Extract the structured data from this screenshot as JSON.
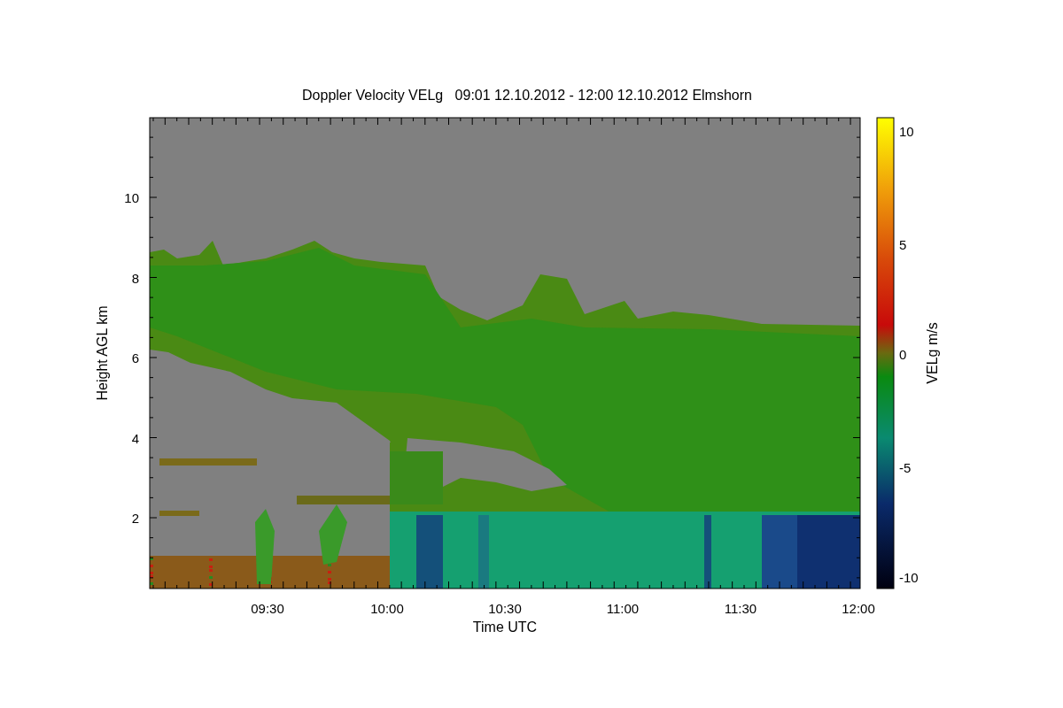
{
  "title": "Doppler Velocity VELg   09:01 12.10.2012 - 12:00 12.10.2012 Elmshorn",
  "plot": {
    "xlabel": "Time UTC",
    "ylabel": "Height AGL km",
    "xtick_labels": [
      "09:30",
      "10:00",
      "10:30",
      "11:00",
      "11:30",
      "12:00"
    ],
    "ytick_labels": [
      "10",
      "8",
      "6",
      "4",
      "2"
    ]
  },
  "colorbar": {
    "label": "VELg m/s",
    "tick_labels": [
      "10",
      "5",
      "0",
      "-5",
      "-10"
    ]
  }
}
